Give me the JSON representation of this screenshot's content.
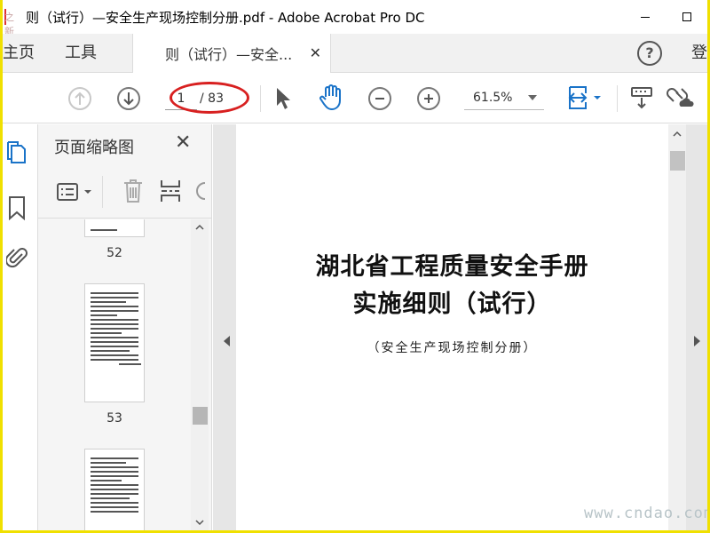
{
  "window": {
    "title": "则（试行）—安全生产现场控制分册.pdf - Adobe Acrobat Pro DC",
    "app_icon_watermark": "之 新 网"
  },
  "tabs": {
    "home": "主页",
    "tools": "工具",
    "document": "则（试行）—安全...",
    "login": "登"
  },
  "toolbar": {
    "current_page": "1",
    "total_pages": "/ 83",
    "zoom": "61.5%"
  },
  "thumbnail_panel": {
    "title": "页面缩略图",
    "thumbnails": [
      {
        "page": "52"
      },
      {
        "page": "53"
      },
      {
        "page": ""
      }
    ]
  },
  "document": {
    "title_line1": "湖北省工程质量安全手册",
    "title_line2": "实施细则（试行）",
    "subtitle": "（安全生产现场控制分册）"
  },
  "watermark": "www.cndao.com",
  "colors": {
    "accent_blue": "#1a73c8",
    "annotation_red": "#d82020",
    "frame_yellow": "#f0e000"
  }
}
